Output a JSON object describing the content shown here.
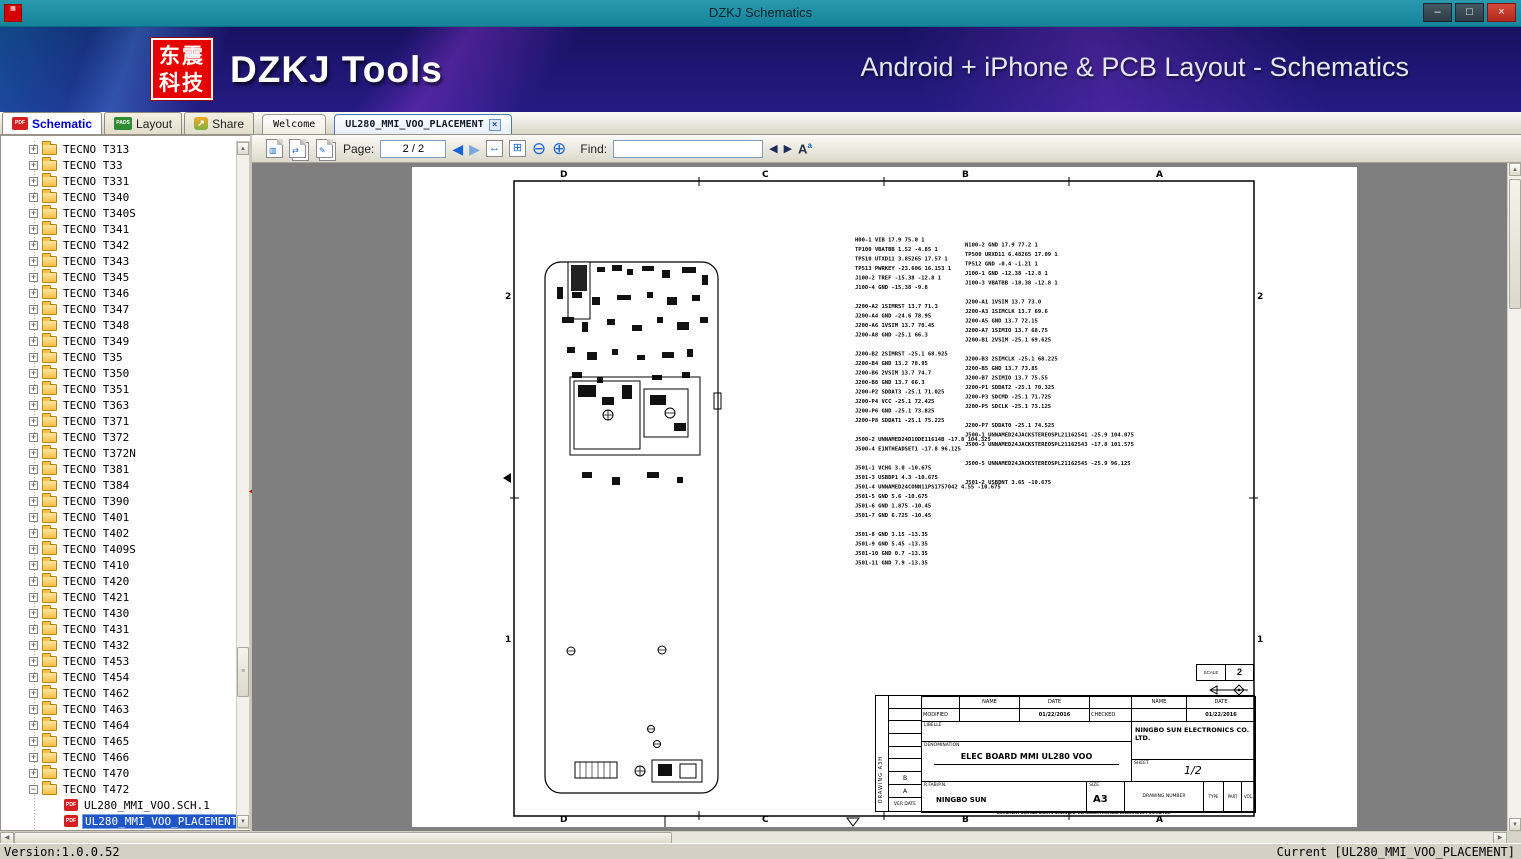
{
  "window": {
    "title": "DZKJ Schematics",
    "status_left": "Version:1.0.0.52",
    "status_right": "Current [UL280_MMI_VOO_PLACEMENT]"
  },
  "icons": {
    "minimize": "–",
    "maximize": "□",
    "close": "×",
    "pdf_badge": "PDF",
    "pads_badge": "PADS",
    "share_glyph": "↗",
    "prev": "◀",
    "next": "▶",
    "zoom_out": "⊖",
    "zoom_in": "⊕",
    "fit_width": "↔",
    "fit_page": "⊞",
    "find_prev": "◀",
    "find_next": "▶",
    "font_a": "A",
    "font_a_sup": "a",
    "up": "▲",
    "down": "▼",
    "left": "◀",
    "right": "▶",
    "thumb_grip": "≡",
    "expand": "+",
    "collapse": "−",
    "splitter": "◄"
  },
  "banner": {
    "logo_line1": "东震",
    "logo_line2": "科技",
    "brand": "DZKJ Tools",
    "tagline": "Android + iPhone & PCB Layout - Schematics"
  },
  "tabs": {
    "app": [
      {
        "label": "Schematic"
      },
      {
        "label": "Layout"
      },
      {
        "label": "Share"
      }
    ],
    "docs": [
      {
        "label": "Welcome"
      },
      {
        "label": "UL280_MMI_VOO_PLACEMENT"
      }
    ]
  },
  "toolbar": {
    "page_label": "Page:",
    "page_value": "2 / 2",
    "find_label": "Find:",
    "find_value": ""
  },
  "sidebar": {
    "items": [
      {
        "label": "TECNO T313"
      },
      {
        "label": "TECNO T33"
      },
      {
        "label": "TECNO T331"
      },
      {
        "label": "TECNO T340"
      },
      {
        "label": "TECNO T340S"
      },
      {
        "label": "TECNO T341"
      },
      {
        "label": "TECNO T342"
      },
      {
        "label": "TECNO T343"
      },
      {
        "label": "TECNO T345"
      },
      {
        "label": "TECNO T346"
      },
      {
        "label": "TECNO T347"
      },
      {
        "label": "TECNO T348"
      },
      {
        "label": "TECNO T349"
      },
      {
        "label": "TECNO T35"
      },
      {
        "label": "TECNO T350"
      },
      {
        "label": "TECNO T351"
      },
      {
        "label": "TECNO T363"
      },
      {
        "label": "TECNO T371"
      },
      {
        "label": "TECNO T372"
      },
      {
        "label": "TECNO T372N"
      },
      {
        "label": "TECNO T381"
      },
      {
        "label": "TECNO T384"
      },
      {
        "label": "TECNO T390"
      },
      {
        "label": "TECNO T401"
      },
      {
        "label": "TECNO T402"
      },
      {
        "label": "TECNO T409S"
      },
      {
        "label": "TECNO T410"
      },
      {
        "label": "TECNO T420"
      },
      {
        "label": "TECNO T421"
      },
      {
        "label": "TECNO T430"
      },
      {
        "label": "TECNO T431"
      },
      {
        "label": "TECNO T432"
      },
      {
        "label": "TECNO T453"
      },
      {
        "label": "TECNO T454"
      },
      {
        "label": "TECNO T462"
      },
      {
        "label": "TECNO T463"
      },
      {
        "label": "TECNO T464"
      },
      {
        "label": "TECNO T465"
      },
      {
        "label": "TECNO T466"
      },
      {
        "label": "TECNO T470"
      },
      {
        "label": "TECNO T472",
        "expanded": true,
        "children": [
          {
            "label": "UL280_MMI_VOO.SCH.1"
          },
          {
            "label": "UL280_MMI_VOO_PLACEMENT",
            "selected": true
          }
        ]
      }
    ]
  },
  "schematic": {
    "grid_top": [
      "D",
      "C",
      "B",
      "A"
    ],
    "grid_bottom": [
      "D",
      "C",
      "B",
      "A"
    ],
    "grid_left": [
      "2",
      "1"
    ],
    "grid_right": [
      "2",
      "1"
    ],
    "left_column": [
      "H00-1 VIB 17.9 75.0 1",
      "TP100 VBATBB 1.52 -4.85 1",
      "TP510 UTXD11 3.85265 17.57 1",
      "TP513 PWRKEY -23.606 16.153 1",
      "J100-2 TREF -15.38 -12.8 1",
      "J100-4 GND -15.38 -9.8",
      "",
      "J200-A2 1SIMRST 13.7 71.3",
      "J200-A4 GND -24.6 78.95",
      "J200-A6 1VSIM 13.7 70.45",
      "J200-A8 GND -25.1 66.3",
      "",
      "J200-B2 2SIMRST -25.1 68.925",
      "J200-B4 GND 13.2 78.95",
      "J200-B6 2VSIM 13.7 74.7",
      "J200-B8 GND 13.7 66.3",
      "J200-P2 SDDAT3 -25.1 71.025",
      "J200-P4 VCC -25.1 72.425",
      "J200-P6 GND -25.1 73.825",
      "J200-P8 SDDAT1 -25.1 75.225",
      "",
      "J500-2 UNNAMED24D1ODE11614B -17.8 104.325",
      "J500-4 E1NTHEADSET1 -17.8 96.125",
      "",
      "J501-1 VCHG 3.0 -10.675",
      "J501-3 USBDP1 4.3 -10.675",
      "J501-4 UNNAMED24CONN11PS1757042 4.55 -10.675",
      "J501-5 GND 5.6 -10.675",
      "J501-6 GND 1.875 -10.45",
      "J501-7 GND 6.725 -10.45",
      "",
      "J501-8 GND 3.15 -13.35",
      "J501-9 GND 5.45 -13.35",
      "J501-10 GND 0.7 -13.35",
      "J501-11 GND 7.9 -13.35"
    ],
    "right_column": [
      "N100-2 GND 17.9 77.2 1",
      "TP500 URXD11 6.48265 17.09 1",
      "TP512 GND -0.4 -1.21 1",
      "J100-1 GND -12.38 -12.8 1",
      "J100-3 VBATBB -18.38 -12.8 1",
      "",
      "J200-A1 1VSIM 13.7 73.0",
      "J200-A3 1SIMCLK 13.7 69.6",
      "J200-A5 GND 13.7 72.15",
      "J200-A7 1SIMIO 13.7 68.75",
      "J200-B1 2VSIM -25.1 69.625",
      "",
      "J200-B3 2SIMCLK -25.1 68.225",
      "J200-B5 GND 13.7 73.85",
      "J200-B7 2SIMIO 13.7 75.55",
      "J200-P1 SDDAT2 -25.1 70.325",
      "J200-P3 SDCMD -25.1 71.725",
      "J200-P5 SDCLK -25.1 73.125",
      "",
      "J200-P7 SDDAT0 -25.1 74.525",
      "J500-1 UNNAMED24JACKSTEREOSPL21162541 -25.9 104.075",
      "J500-3 UNNAMED24JACKSTEREOSPL21162543 -17.8 101.575",
      "",
      "J500-5 UNNAMED24JACKSTEREOSPL21162545 -25.9 96.125",
      "",
      "J501-2 USBDNT 3.65 -10.675"
    ],
    "title_block": {
      "scale_label": "SCALE",
      "scale_value": "2",
      "name_label": "NAME",
      "date_label": "DATE",
      "modified_label": "MODIFIED",
      "modified_date": "01/22/2016",
      "checked_label": "CHECKED",
      "checked_date": "01/22/2016",
      "libelle_label": "LIBELLE",
      "denomination_label": "DENOMINATION",
      "denomination_value": "ELEC BOARD MMI UL280 VOO",
      "company": "NINGBO SUN ELECTRONICS CO. LTD.",
      "sheet_label": "SHEET",
      "sheet_value": "1/2",
      "rfab_label": "R.FAB/P.N.",
      "rfab_value": "NINGBO SUN",
      "size_label": "SIZE",
      "size_value": "A3",
      "drawing_number_label": "DRAWING NUMBER",
      "type_label": "TYPE",
      "part_label": "PART",
      "vol_label": "VOL.",
      "ver_date_label": "VER DATE",
      "rev_a": "A",
      "rev_b": "B",
      "drawing_side_label": "DRAWING A3H",
      "footer_note": "DOCUMENT SUN ALL RIGHTS RESERVED. REPRODUCTION AND DISCLOSURE PROHIBITED"
    }
  }
}
